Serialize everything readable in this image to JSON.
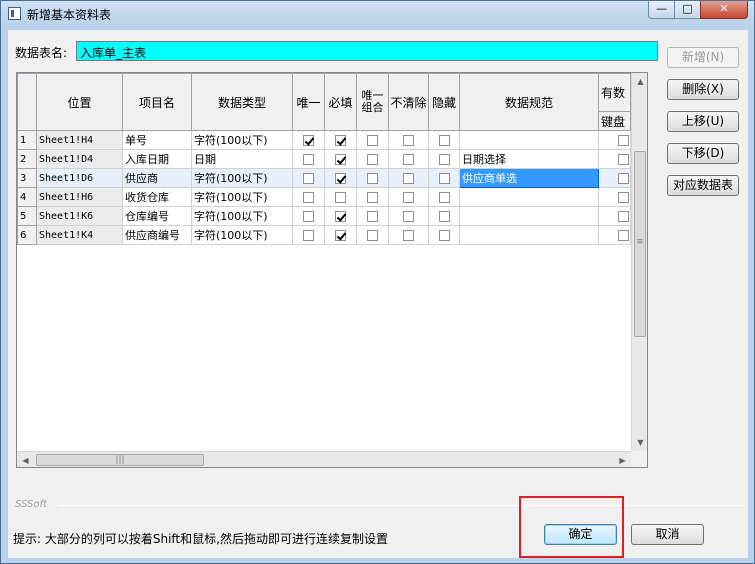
{
  "window": {
    "title": "新增基本资料表",
    "min_glyph": "—",
    "max_glyph": "□",
    "close_glyph": "✕"
  },
  "table_name": {
    "label": "数据表名:",
    "value": "入库单_主表"
  },
  "grid": {
    "columns": {
      "position": "位置",
      "item_name": "项目名",
      "data_type": "数据类型",
      "unique": "唯一",
      "required": "必填",
      "unique_combo": "唯一组合",
      "no_clear": "不清除",
      "hidden": "隐藏",
      "data_rule": "数据规范",
      "valid_top": "有数",
      "valid_sub": "键盘"
    },
    "rows": [
      {
        "num": "1",
        "position": "Sheet1!H4",
        "item_name": "单号",
        "data_type": "字符(100以下)",
        "unique": true,
        "required": true,
        "unique_combo": false,
        "no_clear": false,
        "hidden": false,
        "data_rule": "",
        "active_rule": false,
        "selected": false
      },
      {
        "num": "2",
        "position": "Sheet1!D4",
        "item_name": "入库日期",
        "data_type": "日期",
        "unique": false,
        "required": true,
        "unique_combo": false,
        "no_clear": false,
        "hidden": false,
        "data_rule": "日期选择",
        "active_rule": false,
        "selected": false
      },
      {
        "num": "3",
        "position": "Sheet1!D6",
        "item_name": "供应商",
        "data_type": "字符(100以下)",
        "unique": false,
        "required": true,
        "unique_combo": false,
        "no_clear": false,
        "hidden": false,
        "data_rule": "供应商单选",
        "active_rule": true,
        "selected": true
      },
      {
        "num": "4",
        "position": "Sheet1!H6",
        "item_name": "收货仓库",
        "data_type": "字符(100以下)",
        "unique": false,
        "required": false,
        "unique_combo": false,
        "no_clear": false,
        "hidden": false,
        "data_rule": "",
        "active_rule": false,
        "selected": false
      },
      {
        "num": "5",
        "position": "Sheet1!K6",
        "item_name": "仓库编号",
        "data_type": "字符(100以下)",
        "unique": false,
        "required": true,
        "unique_combo": false,
        "no_clear": false,
        "hidden": false,
        "data_rule": "",
        "active_rule": false,
        "selected": false
      },
      {
        "num": "6",
        "position": "Sheet1!K4",
        "item_name": "供应商编号",
        "data_type": "字符(100以下)",
        "unique": false,
        "required": true,
        "unique_combo": false,
        "no_clear": false,
        "hidden": false,
        "data_rule": "",
        "active_rule": false,
        "selected": false
      }
    ]
  },
  "side_buttons": {
    "add": "新增(N)",
    "delete": "删除(X)",
    "move_up": "上移(U)",
    "move_down": "下移(D)",
    "map_table": "对应数据表"
  },
  "footer": {
    "brand": "SSSoft",
    "hint": "提示: 大部分的列可以按着Shift和鼠标,然后拖动即可进行连续复制设置",
    "ok": "确定",
    "cancel": "取消"
  },
  "colors": {
    "table_name_bg": "#00ffff",
    "active_cell_bg": "#3399ff",
    "highlight_box": "#e02020"
  }
}
